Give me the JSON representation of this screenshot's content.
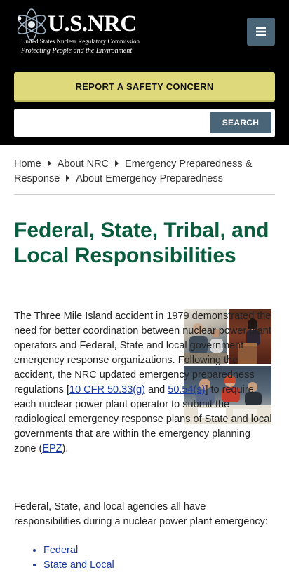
{
  "header": {
    "logo_name": "U.S.NRC",
    "logo_subtitle": "United States Nuclear Regulatory Commission",
    "logo_tagline": "Protecting People and the Environment",
    "menu_icon": "hamburger-icon"
  },
  "safety_button": "REPORT A SAFETY CONCERN",
  "search": {
    "placeholder": "",
    "button": "SEARCH"
  },
  "breadcrumb": [
    "Home",
    "About NRC",
    "Emergency Preparedness & Response",
    "About Emergency Preparedness"
  ],
  "page_title": "Federal, State, Tribal, and Local Responsibilities",
  "intro": {
    "text_a": "The Three Mile Island accident in 1979 demonstrated the need for better coordination between nuclear power plant operators and Federal, State and local government emergency response organizations. Following the accident, the NRC updated emergency preparedness regulations [",
    "link_1": "10 CFR 50.33(g)",
    "text_b": " and ",
    "link_2": "50.54(s)",
    "text_c": "] to require each nuclear power plant operator to submit the radiological emergency response plans of State and local governments that are within the emergency planning zone (",
    "link_3": "EPZ",
    "text_d": ")."
  },
  "para2": "Federal, State, and local agencies all have responsibilities during a nuclear power plant emergency:",
  "list": [
    "Federal",
    "State and Local"
  ],
  "colors": {
    "header_bg": "#000000",
    "safety_bg": "#ded97a",
    "button_bg": "#4a6478",
    "title": "#0a5c3f",
    "link": "#1a3aa8"
  }
}
